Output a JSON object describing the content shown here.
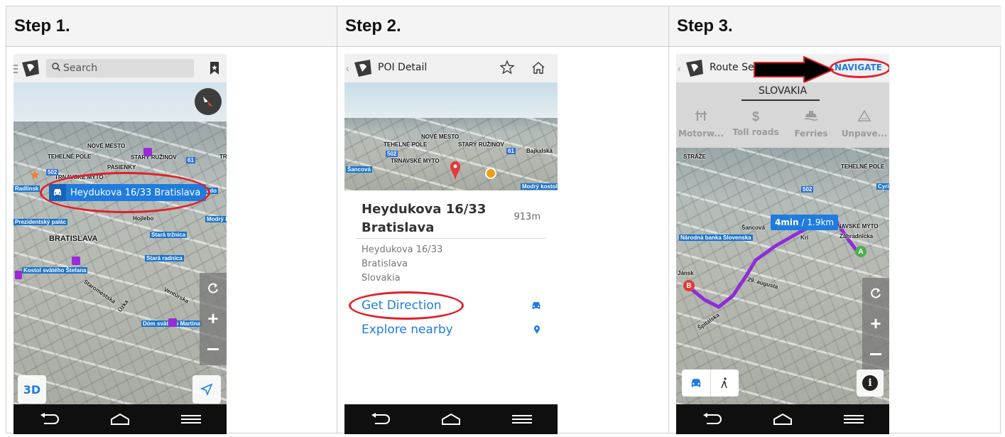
{
  "steps": [
    {
      "title": "Step 1."
    },
    {
      "title": "Step 2."
    },
    {
      "title": "Step 3."
    }
  ],
  "step1": {
    "search_placeholder": "Search",
    "location_bubble": "Heydukova 16/33  Bratislava",
    "mode_3d": "3D",
    "map_labels": [
      "NOVÉ MESTO",
      "TEHELNÉ POLE",
      "STARÝ RUŽINOV",
      "PASIENKY",
      "TRNAVSKÉ MÝTO",
      "BRATISLAVA",
      "Prezidentský palác",
      "Kostol svätého Štefana",
      "Stará tržnica",
      "Stará radnica",
      "Hojlebo",
      "Modrý k",
      "Dóm svätého Martina",
      "Ventúrska",
      "Úzka",
      "Staromestská",
      "Radlinsk",
      "Rado",
      "TR"
    ],
    "road_shields": [
      "502",
      "61"
    ]
  },
  "step2": {
    "title": "POI Detail",
    "poi_name": "Heydukova 16/33 Bratislava",
    "distance": "913m",
    "address_lines": [
      "Heydukova 16/33",
      "Bratislava",
      "Slovakia"
    ],
    "get_direction": "Get Direction",
    "explore_nearby": "Explore nearby",
    "map_labels": [
      "NOVÉ MESTO",
      "TEHELNÉ POLE",
      "STARÝ RUŽINOV",
      "TRNAVSKÉ MÝTO",
      "Šancová",
      "Bajkalská",
      "Modrý kostol"
    ],
    "road_shields": [
      "502",
      "61"
    ]
  },
  "step3": {
    "title": "Route Se",
    "navigate": "NAVIGATE",
    "country": "SLOVAKIA",
    "options": [
      "Motorw...",
      "Toll roads",
      "Ferries",
      "Unpave..."
    ],
    "eta_time": "4min",
    "eta_dist": "/ 1.9km",
    "marker_a": "A",
    "marker_b": "B",
    "map_labels": [
      "STRÁŽE",
      "TEHELNÉ POLE",
      "Šancová",
      "TRNAVSKÉ MÝTO",
      "Národná banka Slovenska",
      "Záhradnícka",
      "29. augusta",
      "Jánsk",
      "Špitálska",
      "Cyril",
      "Krí"
    ],
    "road_shields": [
      "502"
    ]
  },
  "colors": {
    "accent": "#1f7cde",
    "highlight": "#e0202c",
    "route": "#8a2be2",
    "navbar": "#0f0f0f"
  }
}
